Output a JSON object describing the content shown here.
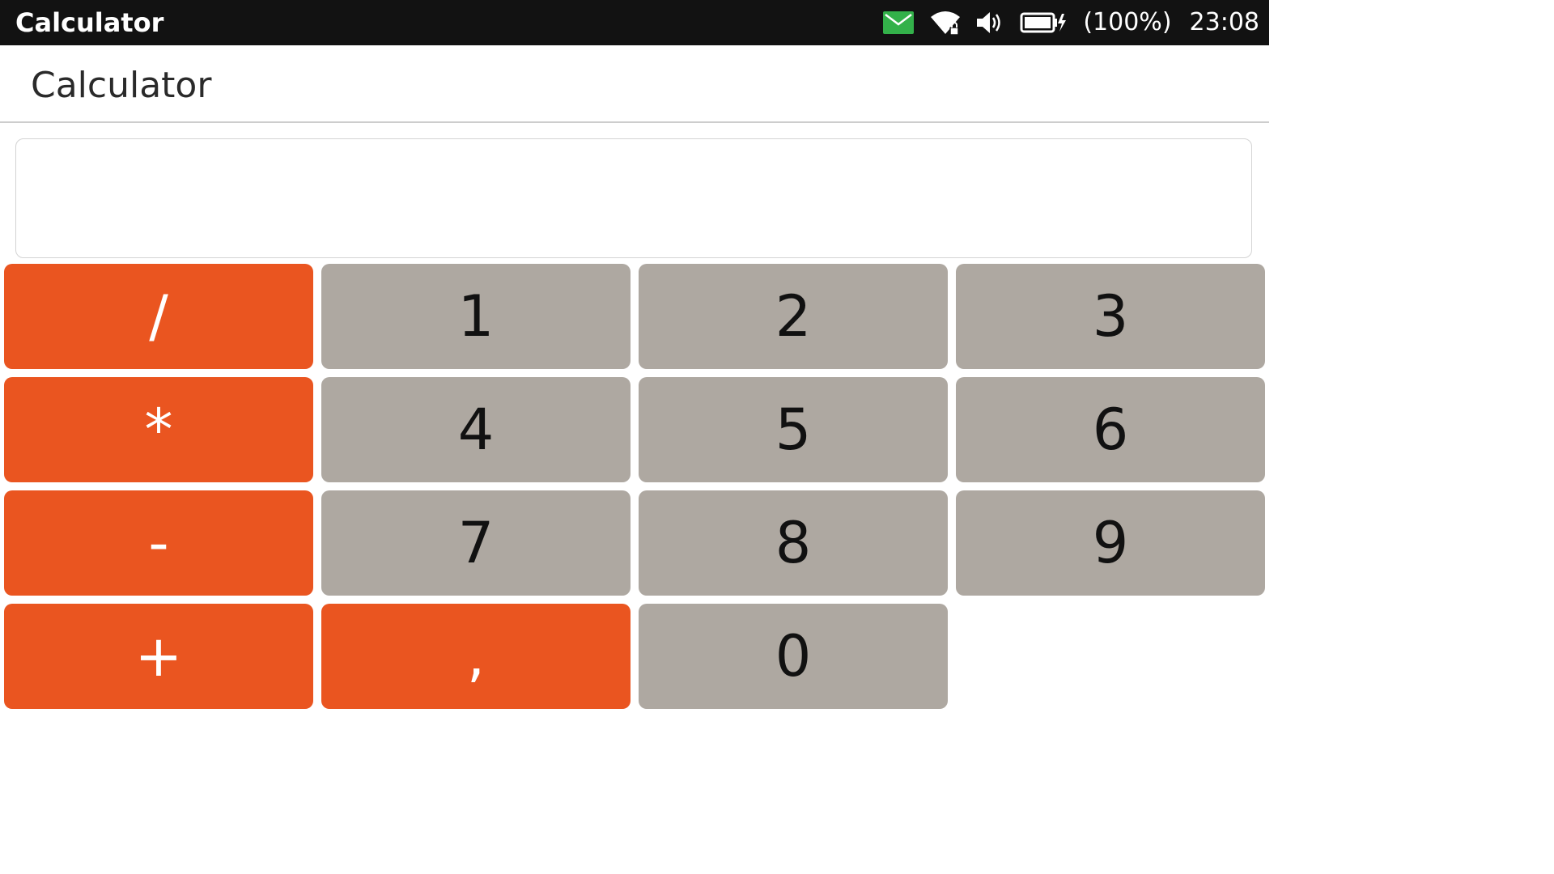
{
  "status_bar": {
    "title": "Calculator",
    "battery_percent": "(100%)",
    "time": "23:08",
    "icons": [
      "mail-icon",
      "wifi-locked-icon",
      "volume-icon",
      "battery-charging-icon"
    ],
    "mail_color": "#33b14a"
  },
  "header": {
    "title": "Calculator"
  },
  "display": {
    "value": ""
  },
  "keys": {
    "divide": "/",
    "one": "1",
    "two": "2",
    "three": "3",
    "multiply": "*",
    "four": "4",
    "five": "5",
    "six": "6",
    "subtract": "-",
    "seven": "7",
    "eight": "8",
    "nine": "9",
    "add": "+",
    "comma": ",",
    "zero": "0"
  },
  "colors": {
    "operator_key": "#ea5520",
    "digit_key": "#aea8a1",
    "status_bar": "#121212"
  }
}
